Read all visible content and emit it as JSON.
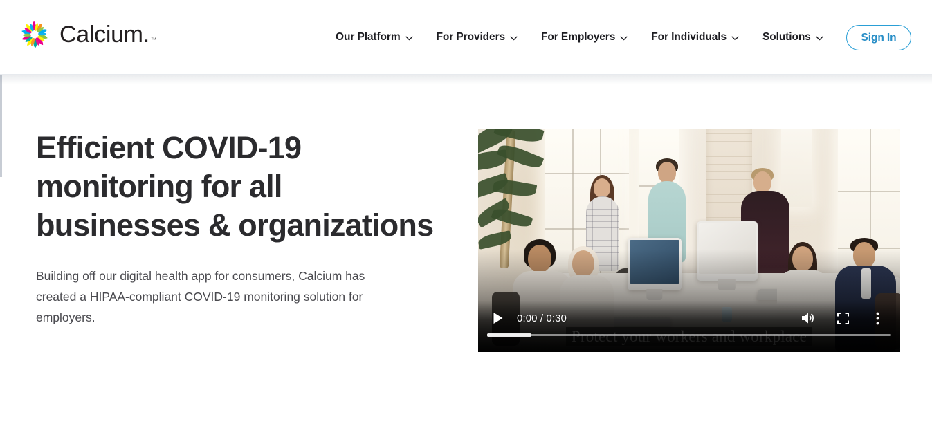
{
  "header": {
    "brand": {
      "name": "Calcium",
      "trademark": ".",
      "logo_icon": "calcium-pinwheel-logo",
      "petal_colors": [
        "#e5007e",
        "#f6a600",
        "#ffe400",
        "#8cc63f",
        "#00a651",
        "#00aeb4",
        "#00a0df",
        "#2e3192",
        "#662d91",
        "#ec008c"
      ]
    },
    "nav": [
      {
        "label": "Our Platform",
        "icon": "chevron-down-icon",
        "has_dropdown": true
      },
      {
        "label": "For Providers",
        "icon": "chevron-down-icon",
        "has_dropdown": true
      },
      {
        "label": "For Employers",
        "icon": "chevron-down-icon",
        "has_dropdown": true
      },
      {
        "label": "For Individuals",
        "icon": "chevron-down-icon",
        "has_dropdown": true
      },
      {
        "label": "Solutions",
        "icon": "chevron-down-icon",
        "has_dropdown": true
      }
    ],
    "signin": {
      "label": "Sign In",
      "text_color": "#2a8fc7",
      "border_color": "#2a9fd6"
    }
  },
  "hero": {
    "title": "Efficient COVID-19 monitoring for all businesses & organizations",
    "subtitle": "Building off our digital health app for consumers, Calcium has created a HIPAA-compliant COVID-19 monitoring solution for employers."
  },
  "video": {
    "caption": "Protect your workers and workplace",
    "scene_description": "Diverse team meeting around a white conference table in a bright open-plan office with tall windows, iMac monitors, laptops and a potted plant",
    "controls": {
      "play_icon": "play-icon",
      "play_label": "Play",
      "time_display": "0:00 / 0:30",
      "current_time": "0:00",
      "duration": "0:30",
      "volume_icon": "volume-on-icon",
      "volume_label": "Mute",
      "fullscreen_icon": "fullscreen-icon",
      "fullscreen_label": "Full screen",
      "more_icon": "more-options-icon",
      "more_label": "More options",
      "progress_percent": 0,
      "loaded_percent": 11
    }
  }
}
